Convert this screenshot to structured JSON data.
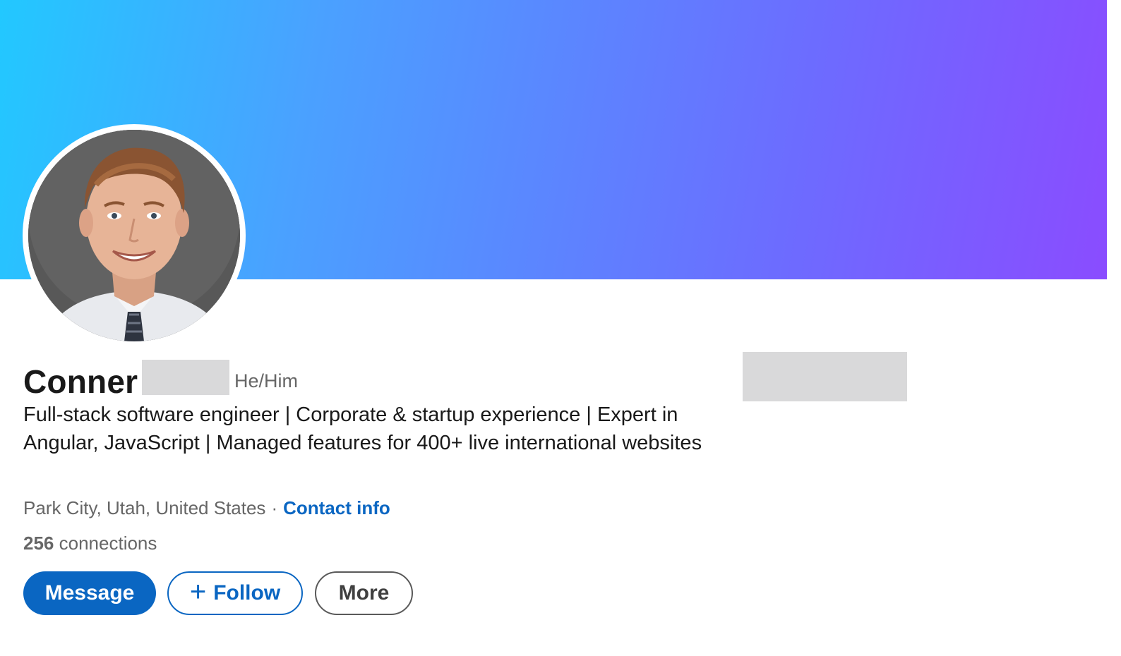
{
  "profile": {
    "first_name": "Conner",
    "pronouns": "He/Him",
    "headline": "Full-stack software engineer | Corporate & startup experience | Expert in Angular, JavaScript | Managed features for 400+ live international websites",
    "location": "Park City, Utah, United States",
    "separator": "·",
    "contact_label": "Contact info",
    "connections_count": "256",
    "connections_label": "connections"
  },
  "actions": {
    "message_label": "Message",
    "follow_icon": "+",
    "follow_label": "Follow",
    "more_label": "More"
  },
  "colors": {
    "brand_blue": "#0a66c2",
    "banner_start": "#22c8ff",
    "banner_end": "#8a4cff",
    "redaction": "#d9d9da"
  },
  "icons": {
    "follow": "plus-icon"
  }
}
